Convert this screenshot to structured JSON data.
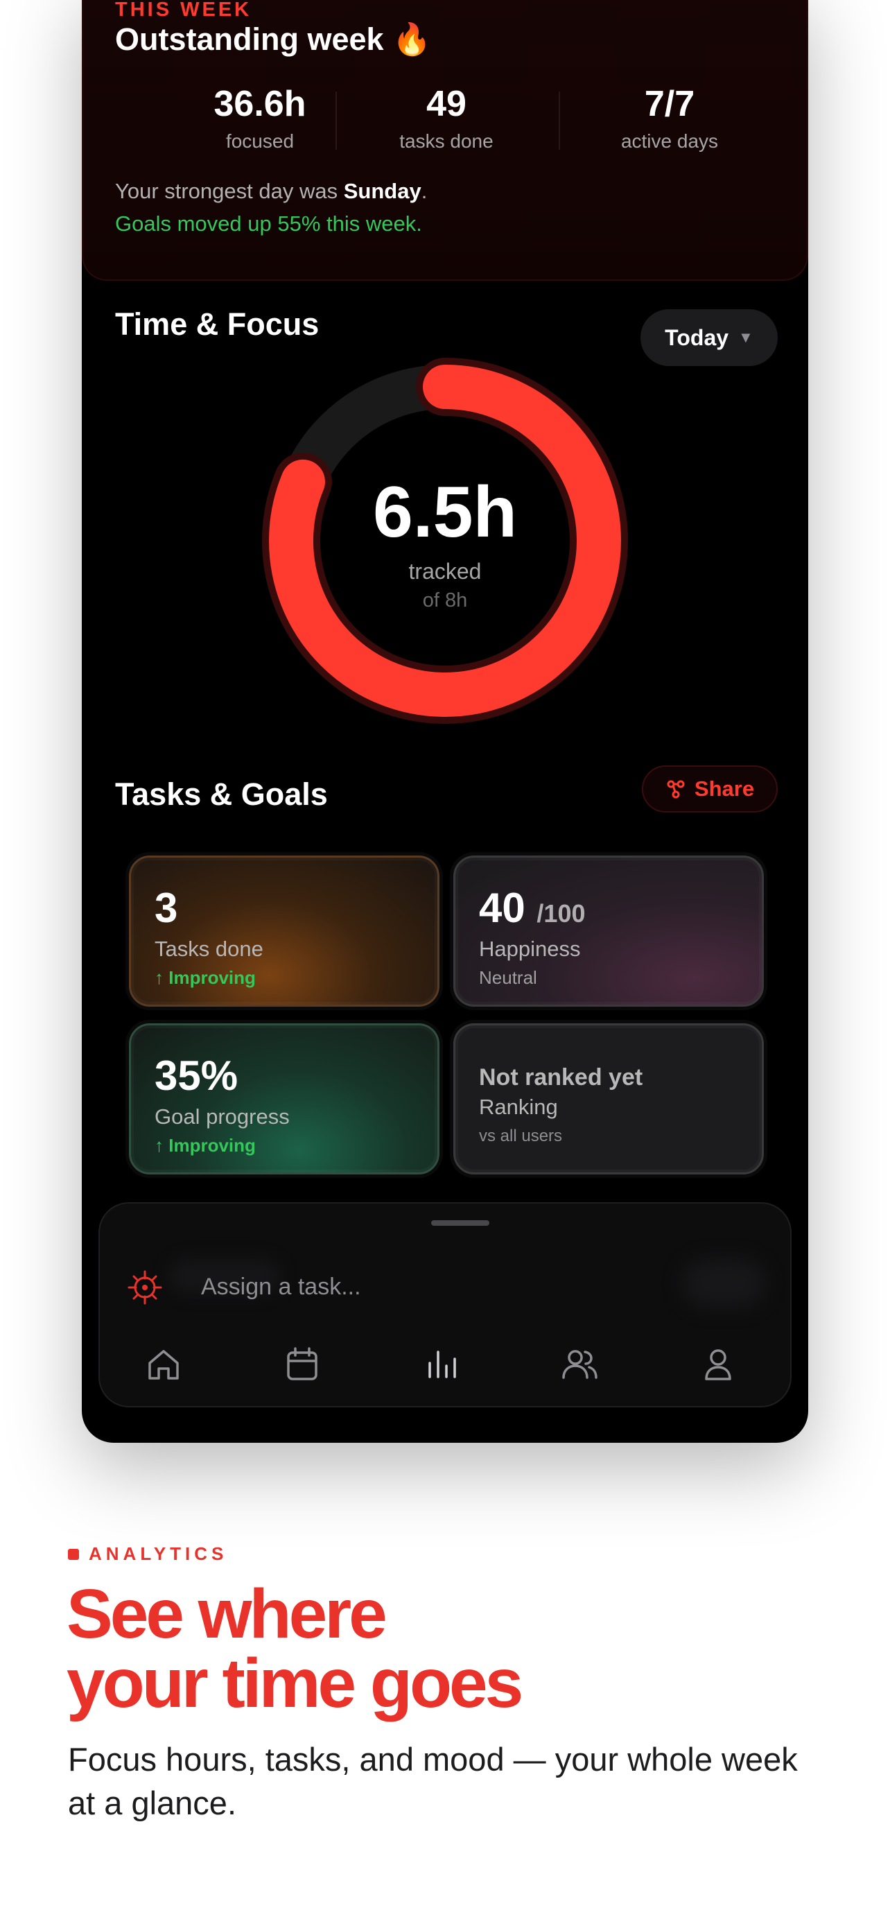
{
  "summary": {
    "eyebrow": "THIS WEEK",
    "title": "Outstanding week 🔥",
    "stats": [
      {
        "value": "36.6h",
        "label": "focused"
      },
      {
        "value": "49",
        "label": "tasks done"
      },
      {
        "value": "7/7",
        "label": "active days"
      }
    ],
    "strongest_prefix": "Your strongest day was ",
    "strongest_day": "Sunday",
    "strongest_suffix": ".",
    "goals_line": "Goals moved up 55% this week."
  },
  "time_focus": {
    "title": "Time & Focus",
    "range": "Today",
    "tracked_value": "6.5h",
    "tracked_label": "tracked",
    "goal_label": "of 8h",
    "progress_fraction": 0.8125
  },
  "tasks_goals": {
    "title": "Tasks & Goals",
    "share_label": "Share",
    "tiles": {
      "tasks": {
        "value": "3",
        "label": "Tasks done",
        "note": "↑ Improving"
      },
      "happiness": {
        "value": "40",
        "denominator": "/100",
        "label": "Happiness",
        "note": "Neutral"
      },
      "goals": {
        "value": "35%",
        "label": "Goal progress",
        "note": "↑ Improving"
      },
      "ranking": {
        "value": "Not ranked yet",
        "label": "Ranking",
        "note": "vs all users"
      }
    }
  },
  "bottom_bar": {
    "placeholder": "Assign a task...",
    "nav": [
      "home-icon",
      "calendar-icon",
      "analytics-icon",
      "team-icon",
      "profile-icon"
    ],
    "active": "analytics-icon"
  },
  "marketing": {
    "eyebrow": "ANALYTICS",
    "headline_line1": "See where",
    "headline_line2": "your time goes",
    "subtitle": "Focus hours, tasks, and mood — your whole week at a glance."
  },
  "colors": {
    "accent": "#ff3b30",
    "brand_red": "#e8322a",
    "positive": "#34c759"
  }
}
